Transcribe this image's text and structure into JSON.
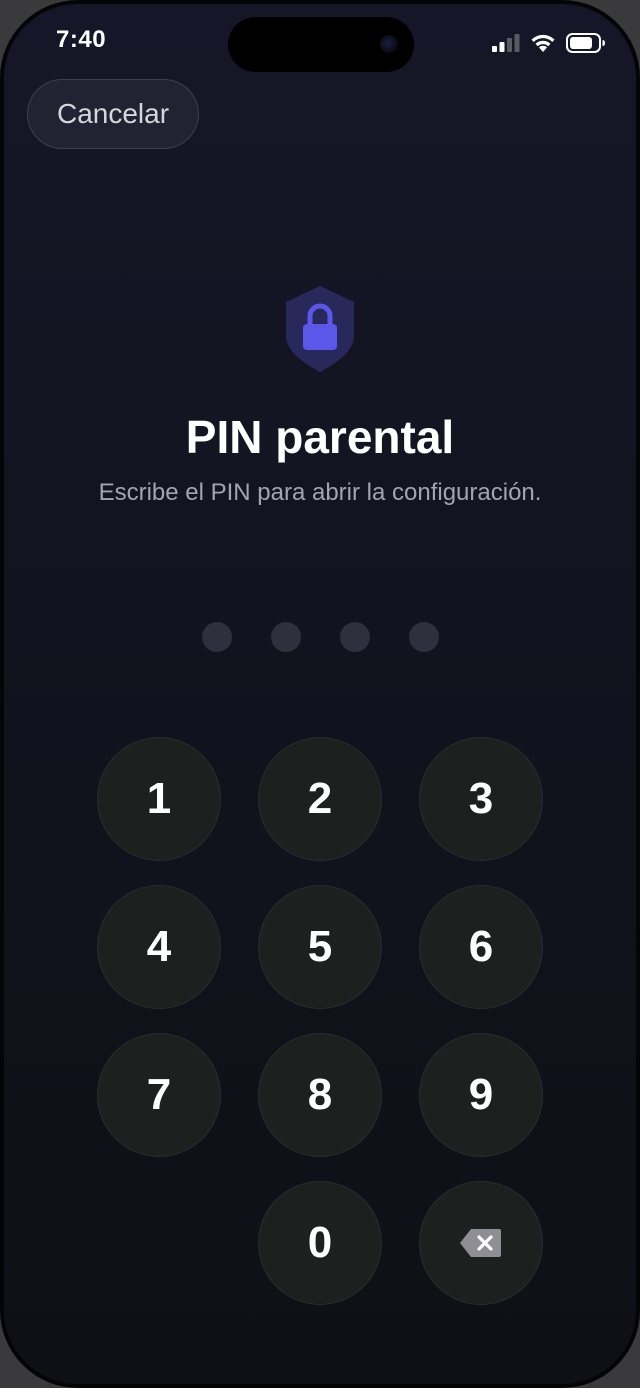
{
  "status_bar": {
    "time": "7:40",
    "icons": [
      "cellular-signal-icon",
      "wifi-icon",
      "battery-icon"
    ]
  },
  "header": {
    "cancel_label": "Cancelar"
  },
  "lock": {
    "icon": "shield-lock-icon",
    "title": "PIN parental",
    "subtitle": "Escribe el PIN para abrir la configuración."
  },
  "pin": {
    "length": 4,
    "entered": 0
  },
  "keypad": {
    "keys": [
      "1",
      "2",
      "3",
      "4",
      "5",
      "6",
      "7",
      "8",
      "9",
      "0"
    ],
    "delete_icon": "backspace-icon"
  },
  "colors": {
    "background": "#13131f",
    "accent": "#5b57e8",
    "key_background": "#1e1f1f",
    "dot_empty": "#2f2f3d"
  }
}
